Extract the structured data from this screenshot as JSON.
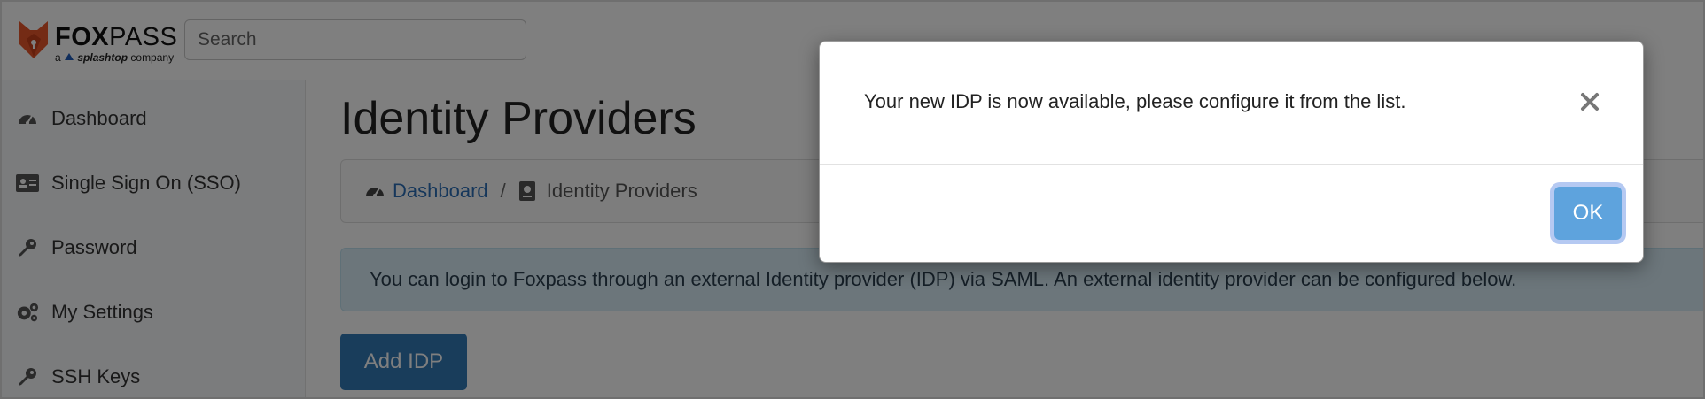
{
  "logo": {
    "word_bold": "FOX",
    "word_regular": "PASS",
    "sub_prefix": "a",
    "sub_brand": "splashtop",
    "sub_suffix": "company",
    "brand_color": "#e8562a"
  },
  "search": {
    "placeholder": "Search"
  },
  "sidebar": {
    "items": [
      {
        "label": "Dashboard",
        "icon": "dashboard-icon"
      },
      {
        "label": "Single Sign On (SSO)",
        "icon": "id-card-icon"
      },
      {
        "label": "Password",
        "icon": "key-icon"
      },
      {
        "label": "My Settings",
        "icon": "gears-icon"
      },
      {
        "label": "SSH Keys",
        "icon": "key-icon"
      }
    ]
  },
  "main": {
    "title": "Identity Providers",
    "breadcrumb": {
      "link_label": "Dashboard",
      "separator": "/",
      "current_label": "Identity Providers"
    },
    "info_text": "You can login to Foxpass through an external Identity provider (IDP) via SAML. An external identity provider can be configured below.",
    "add_button": "Add IDP"
  },
  "modal": {
    "message": "Your new IDP is now available, please configure it from the list.",
    "ok_label": "OK",
    "close_icon": "close-icon"
  },
  "colors": {
    "primary": "#337ab7",
    "link": "#2c6fb7",
    "info_bg": "#d9edf7",
    "ok_button": "#5ea3dd"
  }
}
